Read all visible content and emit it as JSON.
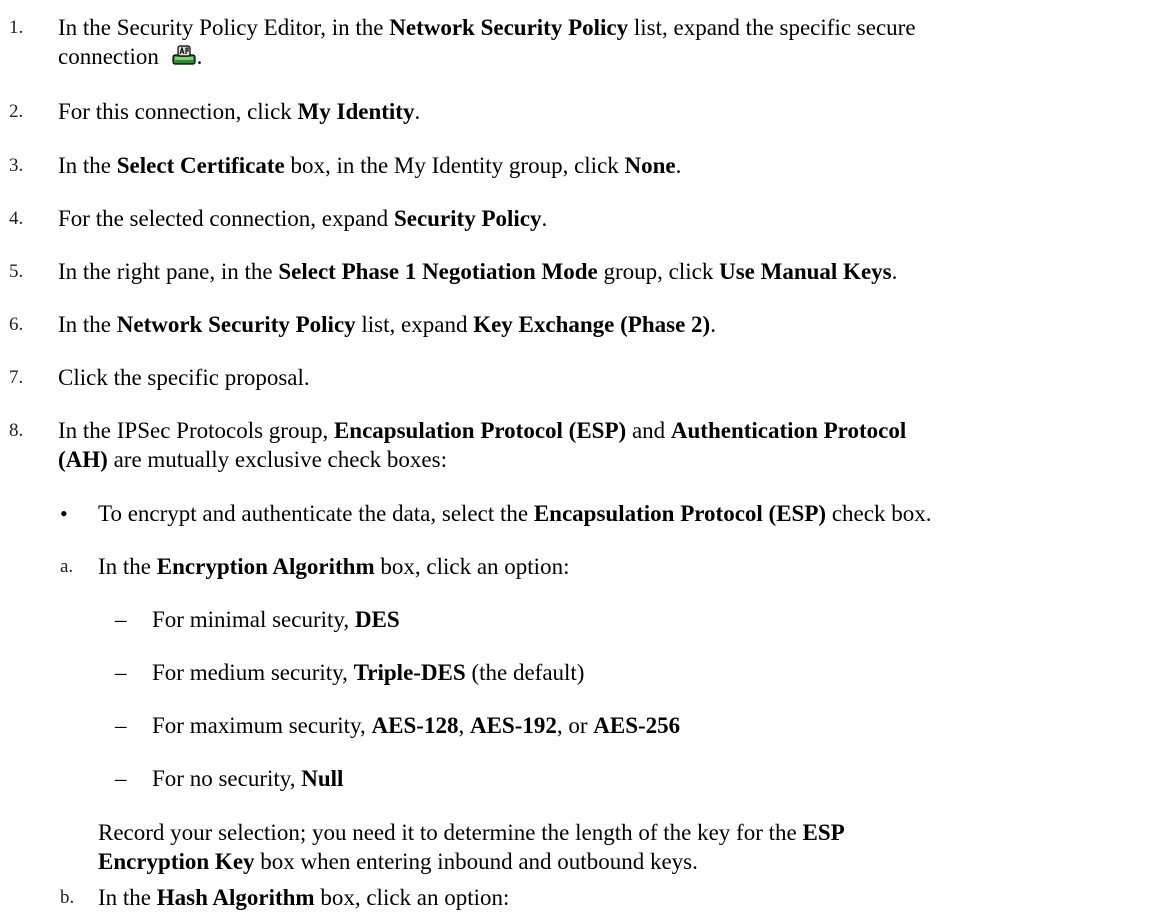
{
  "steps": [
    {
      "num": "1.",
      "p1": "In the Security Policy Editor, in the ",
      "b1": "Network Security Policy",
      "p2": " list, expand the specific secure",
      "p3": "connection ",
      "p4": "."
    },
    {
      "num": "2.",
      "p1": "For this connection, click ",
      "b1": "My Identity",
      "p2": "."
    },
    {
      "num": "3.",
      "p1": "In the ",
      "b1": "Select Certificate",
      "p2": " box, in the My Identity group, click ",
      "b2": "None",
      "p3": "."
    },
    {
      "num": "4.",
      "p1": "For the selected connection, expand ",
      "b1": "Security Policy",
      "p2": "."
    },
    {
      "num": "5.",
      "p1": "In the right pane, in the ",
      "b1": "Select Phase 1 Negotiation Mode",
      "p2": " group, click ",
      "b2": "Use Manual Keys",
      "p3": "."
    },
    {
      "num": "6.",
      "p1": "In the ",
      "b1": "Network Security Policy",
      "p2": " list, expand ",
      "b2": "Key Exchange (Phase 2)",
      "p3": "."
    },
    {
      "num": "7.",
      "p1": "Click the specific proposal."
    },
    {
      "num": "8.",
      "p1": "In the IPSec Protocols group, ",
      "b1": "Encapsulation Protocol (ESP)",
      "p2": " and ",
      "b2": "Authentication Protocol",
      "b3": "(AH)",
      "p3": " are mutually exclusive check boxes:"
    }
  ],
  "bullet": {
    "mark": "•",
    "p1": "To encrypt and authenticate the data, select the ",
    "b1": "Encapsulation Protocol (ESP)",
    "p2": " check box."
  },
  "sub_a": {
    "label": "a.",
    "p1": "In the ",
    "b1": "Encryption Algorithm",
    "p2": " box, click an option:"
  },
  "dashes": [
    {
      "mark": "–",
      "p1": "For minimal security, ",
      "b1": "DES"
    },
    {
      "mark": "–",
      "p1": "For medium security, ",
      "b1": "Triple-DES",
      "p2": " (the default)"
    },
    {
      "mark": "–",
      "p1": "For maximum security, ",
      "b1": "AES-128",
      "p2": ", ",
      "b2": "AES-192",
      "p3": ", or ",
      "b3": "AES-256"
    },
    {
      "mark": "–",
      "p1": "For no security, ",
      "b1": "Null"
    }
  ],
  "record": {
    "p1": "Record your selection; you need it to determine the length of the key for the ",
    "b1": "ESP",
    "b2": "Encryption Key",
    "p2": " box when entering inbound and outbound keys."
  },
  "sub_b": {
    "label": "b.",
    "p1": "In the ",
    "b1": "Hash Algorithm",
    "p2": " box, click an option:"
  },
  "icons": {
    "connection": "secure-connection-icon"
  }
}
